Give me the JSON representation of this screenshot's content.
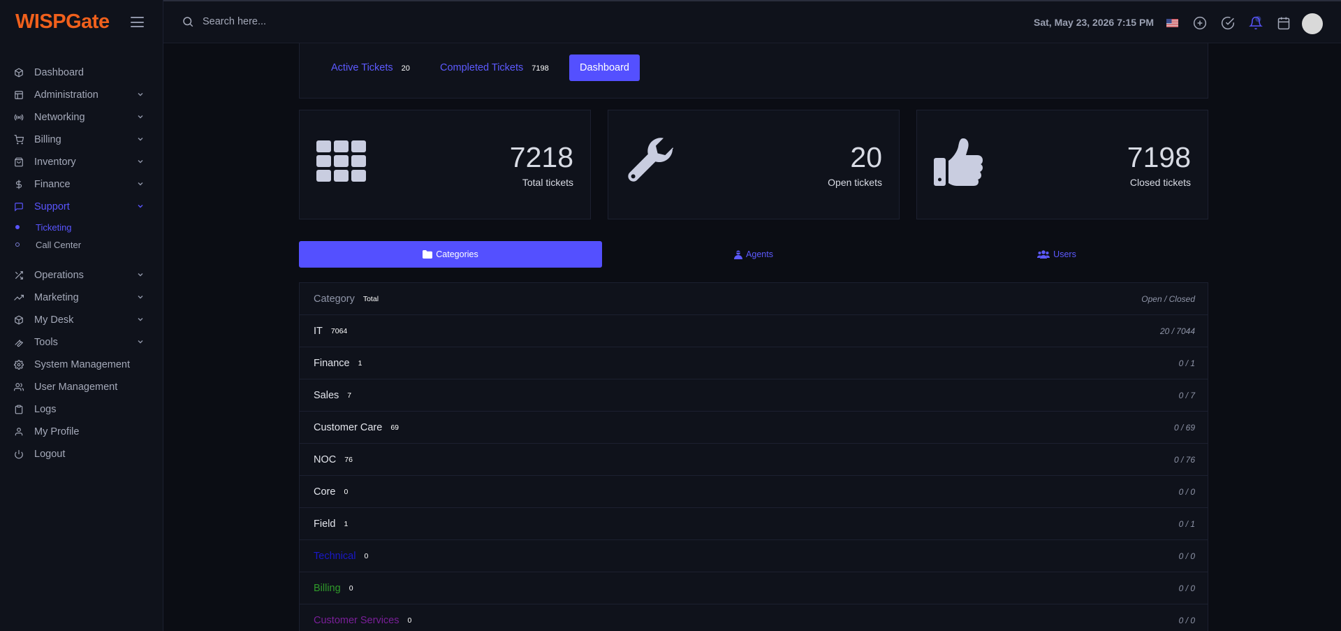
{
  "brand": {
    "name": "WISPGate",
    "accent": "#f0601c"
  },
  "colors": {
    "primary": "#5450ff",
    "background": "#0b0d14",
    "panel": "#0f121b",
    "technical": "#1a18c9",
    "billing": "#2f9a2a",
    "customer_services": "#7a1f99"
  },
  "sidebar": {
    "items": [
      {
        "label": "Dashboard",
        "icon": "cube-icon"
      },
      {
        "label": "Administration",
        "icon": "layout-icon"
      },
      {
        "label": "Networking",
        "icon": "broadcast-icon"
      },
      {
        "label": "Billing",
        "icon": "cart-icon"
      },
      {
        "label": "Inventory",
        "icon": "bag-icon"
      },
      {
        "label": "Finance",
        "icon": "dollar-icon"
      },
      {
        "label": "Support",
        "icon": "chat-icon"
      },
      {
        "label": "Operations",
        "icon": "shuffle-icon"
      },
      {
        "label": "Marketing",
        "icon": "trending-icon"
      },
      {
        "label": "My Desk",
        "icon": "box-icon"
      },
      {
        "label": "Tools",
        "icon": "wrench-icon"
      },
      {
        "label": "System Management",
        "icon": "gear-icon"
      },
      {
        "label": "User Management",
        "icon": "users-icon"
      },
      {
        "label": "Logs",
        "icon": "clipboard-icon"
      },
      {
        "label": "My Profile",
        "icon": "user-icon"
      },
      {
        "label": "Logout",
        "icon": "power-icon"
      }
    ],
    "support_sub": [
      {
        "label": "Ticketing"
      },
      {
        "label": "Call Center"
      }
    ]
  },
  "topbar": {
    "search_placeholder": "Search here...",
    "datetime": "Sat, May 23, 2026 7:15 PM"
  },
  "tabs": {
    "active_label": "Active Tickets",
    "active_count": "20",
    "completed_label": "Completed Tickets",
    "completed_count": "7198",
    "dashboard_label": "Dashboard"
  },
  "stats": [
    {
      "value": "7218",
      "label": "Total tickets",
      "icon": "grid-icon"
    },
    {
      "value": "20",
      "label": "Open tickets",
      "icon": "wrench-icon"
    },
    {
      "value": "7198",
      "label": "Closed tickets",
      "icon": "thumbs-up-icon"
    }
  ],
  "segments": {
    "categories": "Categories",
    "agents": "Agents",
    "users": "Users"
  },
  "table": {
    "head_name": "Category",
    "head_total": "Total",
    "head_ratio": "Open / Closed",
    "rows": [
      {
        "name": "IT",
        "total": "7064",
        "ratio": "20 / 7044"
      },
      {
        "name": "Finance",
        "total": "1",
        "ratio": "0 / 1"
      },
      {
        "name": "Sales",
        "total": "7",
        "ratio": "0 / 7"
      },
      {
        "name": "Customer Care",
        "total": "69",
        "ratio": "0 / 69"
      },
      {
        "name": "NOC",
        "total": "76",
        "ratio": "0 / 76"
      },
      {
        "name": "Core",
        "total": "0",
        "ratio": "0 / 0"
      },
      {
        "name": "Field",
        "total": "1",
        "ratio": "0 / 1"
      },
      {
        "name": "Technical",
        "total": "0",
        "ratio": "0 / 0"
      },
      {
        "name": "Billing",
        "total": "0",
        "ratio": "0 / 0"
      },
      {
        "name": "Customer Services",
        "total": "0",
        "ratio": "0 / 0"
      }
    ]
  }
}
